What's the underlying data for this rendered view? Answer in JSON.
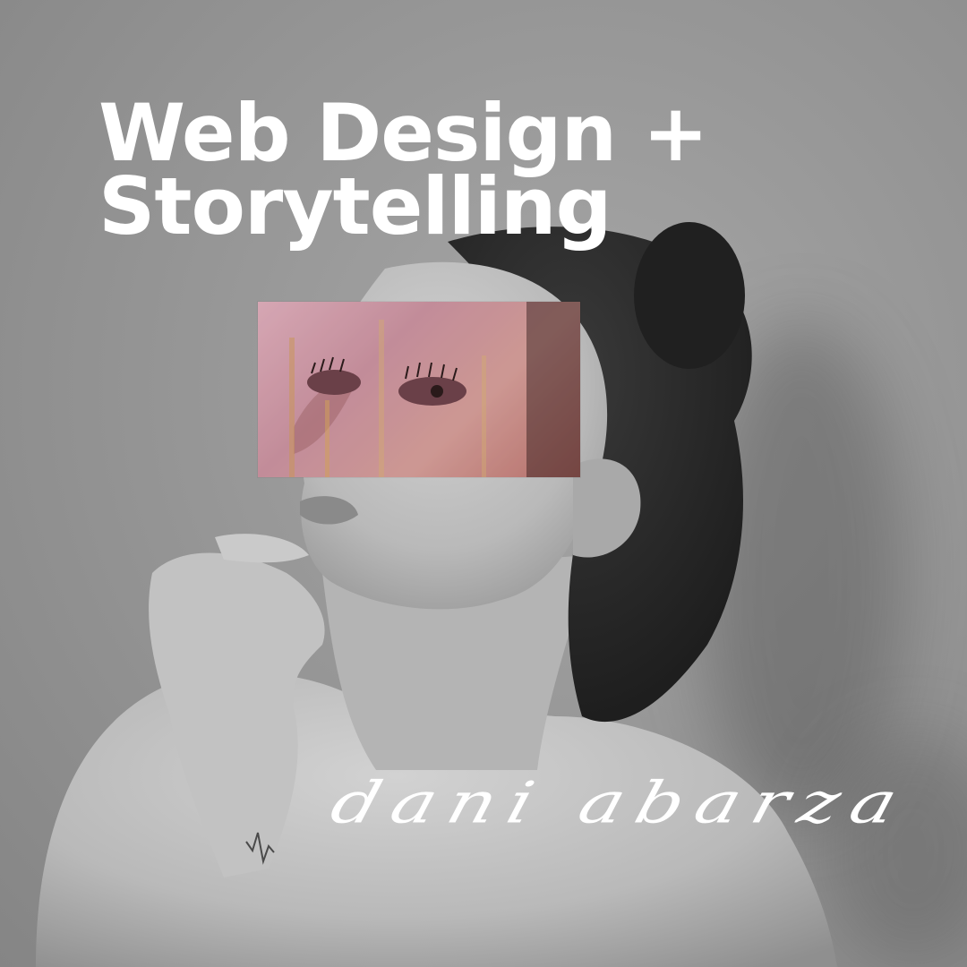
{
  "headline": {
    "line1": "Web Design +",
    "line2": "Storytelling"
  },
  "signature": {
    "text": "dani abarza"
  },
  "colors": {
    "text": "#ffffff",
    "photo_tone": "grayscale",
    "overlay_tone": "#c48e98"
  }
}
